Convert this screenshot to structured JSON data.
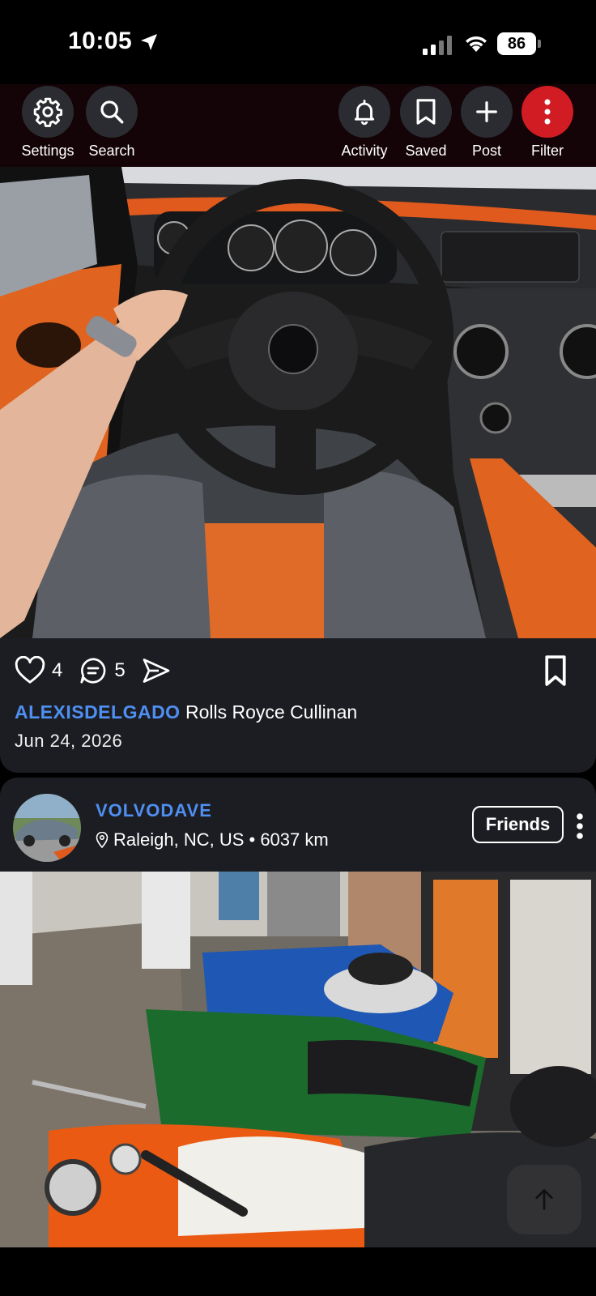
{
  "status_bar": {
    "time": "10:05",
    "battery": "86"
  },
  "nav": {
    "settings": "Settings",
    "search": "Search",
    "activity": "Activity",
    "saved": "Saved",
    "post": "Post",
    "filter": "Filter"
  },
  "post1": {
    "likes": "4",
    "comments": "5",
    "username": "ALEXISDELGADO",
    "caption": "Rolls Royce Cullinan",
    "date": "Jun 24, 2026"
  },
  "post2": {
    "username": "VOLVODAVE",
    "location": "Raleigh, NC, US • 6037 km",
    "friends_label": "Friends"
  },
  "colors": {
    "accent_blue": "#4f8ff2",
    "filter_red": "#d21c23",
    "card_bg": "#1c1d22"
  }
}
